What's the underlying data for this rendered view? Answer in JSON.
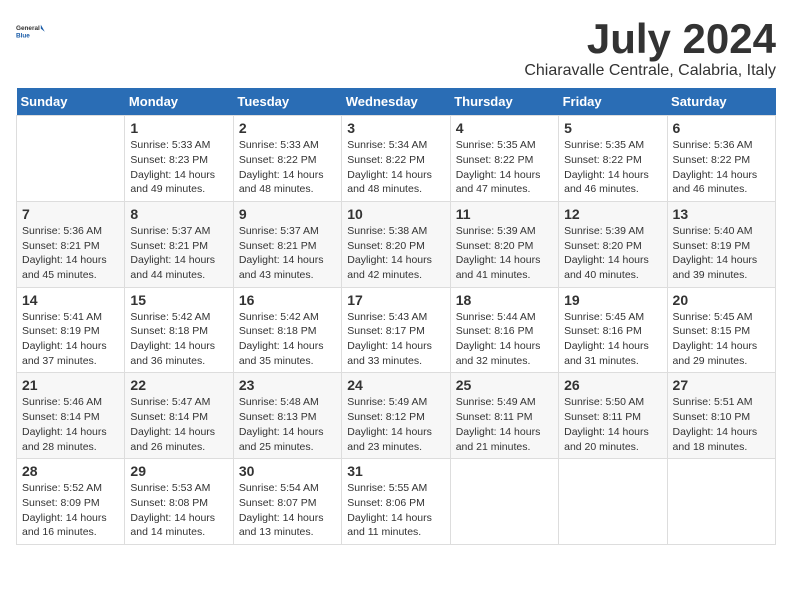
{
  "logo": {
    "general": "General",
    "blue": "Blue"
  },
  "title": "July 2024",
  "subtitle": "Chiaravalle Centrale, Calabria, Italy",
  "weekdays": [
    "Sunday",
    "Monday",
    "Tuesday",
    "Wednesday",
    "Thursday",
    "Friday",
    "Saturday"
  ],
  "weeks": [
    [
      {
        "day": "",
        "text": ""
      },
      {
        "day": "1",
        "text": "Sunrise: 5:33 AM\nSunset: 8:23 PM\nDaylight: 14 hours\nand 49 minutes."
      },
      {
        "day": "2",
        "text": "Sunrise: 5:33 AM\nSunset: 8:22 PM\nDaylight: 14 hours\nand 48 minutes."
      },
      {
        "day": "3",
        "text": "Sunrise: 5:34 AM\nSunset: 8:22 PM\nDaylight: 14 hours\nand 48 minutes."
      },
      {
        "day": "4",
        "text": "Sunrise: 5:35 AM\nSunset: 8:22 PM\nDaylight: 14 hours\nand 47 minutes."
      },
      {
        "day": "5",
        "text": "Sunrise: 5:35 AM\nSunset: 8:22 PM\nDaylight: 14 hours\nand 46 minutes."
      },
      {
        "day": "6",
        "text": "Sunrise: 5:36 AM\nSunset: 8:22 PM\nDaylight: 14 hours\nand 46 minutes."
      }
    ],
    [
      {
        "day": "7",
        "text": "Sunrise: 5:36 AM\nSunset: 8:21 PM\nDaylight: 14 hours\nand 45 minutes."
      },
      {
        "day": "8",
        "text": "Sunrise: 5:37 AM\nSunset: 8:21 PM\nDaylight: 14 hours\nand 44 minutes."
      },
      {
        "day": "9",
        "text": "Sunrise: 5:37 AM\nSunset: 8:21 PM\nDaylight: 14 hours\nand 43 minutes."
      },
      {
        "day": "10",
        "text": "Sunrise: 5:38 AM\nSunset: 8:20 PM\nDaylight: 14 hours\nand 42 minutes."
      },
      {
        "day": "11",
        "text": "Sunrise: 5:39 AM\nSunset: 8:20 PM\nDaylight: 14 hours\nand 41 minutes."
      },
      {
        "day": "12",
        "text": "Sunrise: 5:39 AM\nSunset: 8:20 PM\nDaylight: 14 hours\nand 40 minutes."
      },
      {
        "day": "13",
        "text": "Sunrise: 5:40 AM\nSunset: 8:19 PM\nDaylight: 14 hours\nand 39 minutes."
      }
    ],
    [
      {
        "day": "14",
        "text": "Sunrise: 5:41 AM\nSunset: 8:19 PM\nDaylight: 14 hours\nand 37 minutes."
      },
      {
        "day": "15",
        "text": "Sunrise: 5:42 AM\nSunset: 8:18 PM\nDaylight: 14 hours\nand 36 minutes."
      },
      {
        "day": "16",
        "text": "Sunrise: 5:42 AM\nSunset: 8:18 PM\nDaylight: 14 hours\nand 35 minutes."
      },
      {
        "day": "17",
        "text": "Sunrise: 5:43 AM\nSunset: 8:17 PM\nDaylight: 14 hours\nand 33 minutes."
      },
      {
        "day": "18",
        "text": "Sunrise: 5:44 AM\nSunset: 8:16 PM\nDaylight: 14 hours\nand 32 minutes."
      },
      {
        "day": "19",
        "text": "Sunrise: 5:45 AM\nSunset: 8:16 PM\nDaylight: 14 hours\nand 31 minutes."
      },
      {
        "day": "20",
        "text": "Sunrise: 5:45 AM\nSunset: 8:15 PM\nDaylight: 14 hours\nand 29 minutes."
      }
    ],
    [
      {
        "day": "21",
        "text": "Sunrise: 5:46 AM\nSunset: 8:14 PM\nDaylight: 14 hours\nand 28 minutes."
      },
      {
        "day": "22",
        "text": "Sunrise: 5:47 AM\nSunset: 8:14 PM\nDaylight: 14 hours\nand 26 minutes."
      },
      {
        "day": "23",
        "text": "Sunrise: 5:48 AM\nSunset: 8:13 PM\nDaylight: 14 hours\nand 25 minutes."
      },
      {
        "day": "24",
        "text": "Sunrise: 5:49 AM\nSunset: 8:12 PM\nDaylight: 14 hours\nand 23 minutes."
      },
      {
        "day": "25",
        "text": "Sunrise: 5:49 AM\nSunset: 8:11 PM\nDaylight: 14 hours\nand 21 minutes."
      },
      {
        "day": "26",
        "text": "Sunrise: 5:50 AM\nSunset: 8:11 PM\nDaylight: 14 hours\nand 20 minutes."
      },
      {
        "day": "27",
        "text": "Sunrise: 5:51 AM\nSunset: 8:10 PM\nDaylight: 14 hours\nand 18 minutes."
      }
    ],
    [
      {
        "day": "28",
        "text": "Sunrise: 5:52 AM\nSunset: 8:09 PM\nDaylight: 14 hours\nand 16 minutes."
      },
      {
        "day": "29",
        "text": "Sunrise: 5:53 AM\nSunset: 8:08 PM\nDaylight: 14 hours\nand 14 minutes."
      },
      {
        "day": "30",
        "text": "Sunrise: 5:54 AM\nSunset: 8:07 PM\nDaylight: 14 hours\nand 13 minutes."
      },
      {
        "day": "31",
        "text": "Sunrise: 5:55 AM\nSunset: 8:06 PM\nDaylight: 14 hours\nand 11 minutes."
      },
      {
        "day": "",
        "text": ""
      },
      {
        "day": "",
        "text": ""
      },
      {
        "day": "",
        "text": ""
      }
    ]
  ]
}
